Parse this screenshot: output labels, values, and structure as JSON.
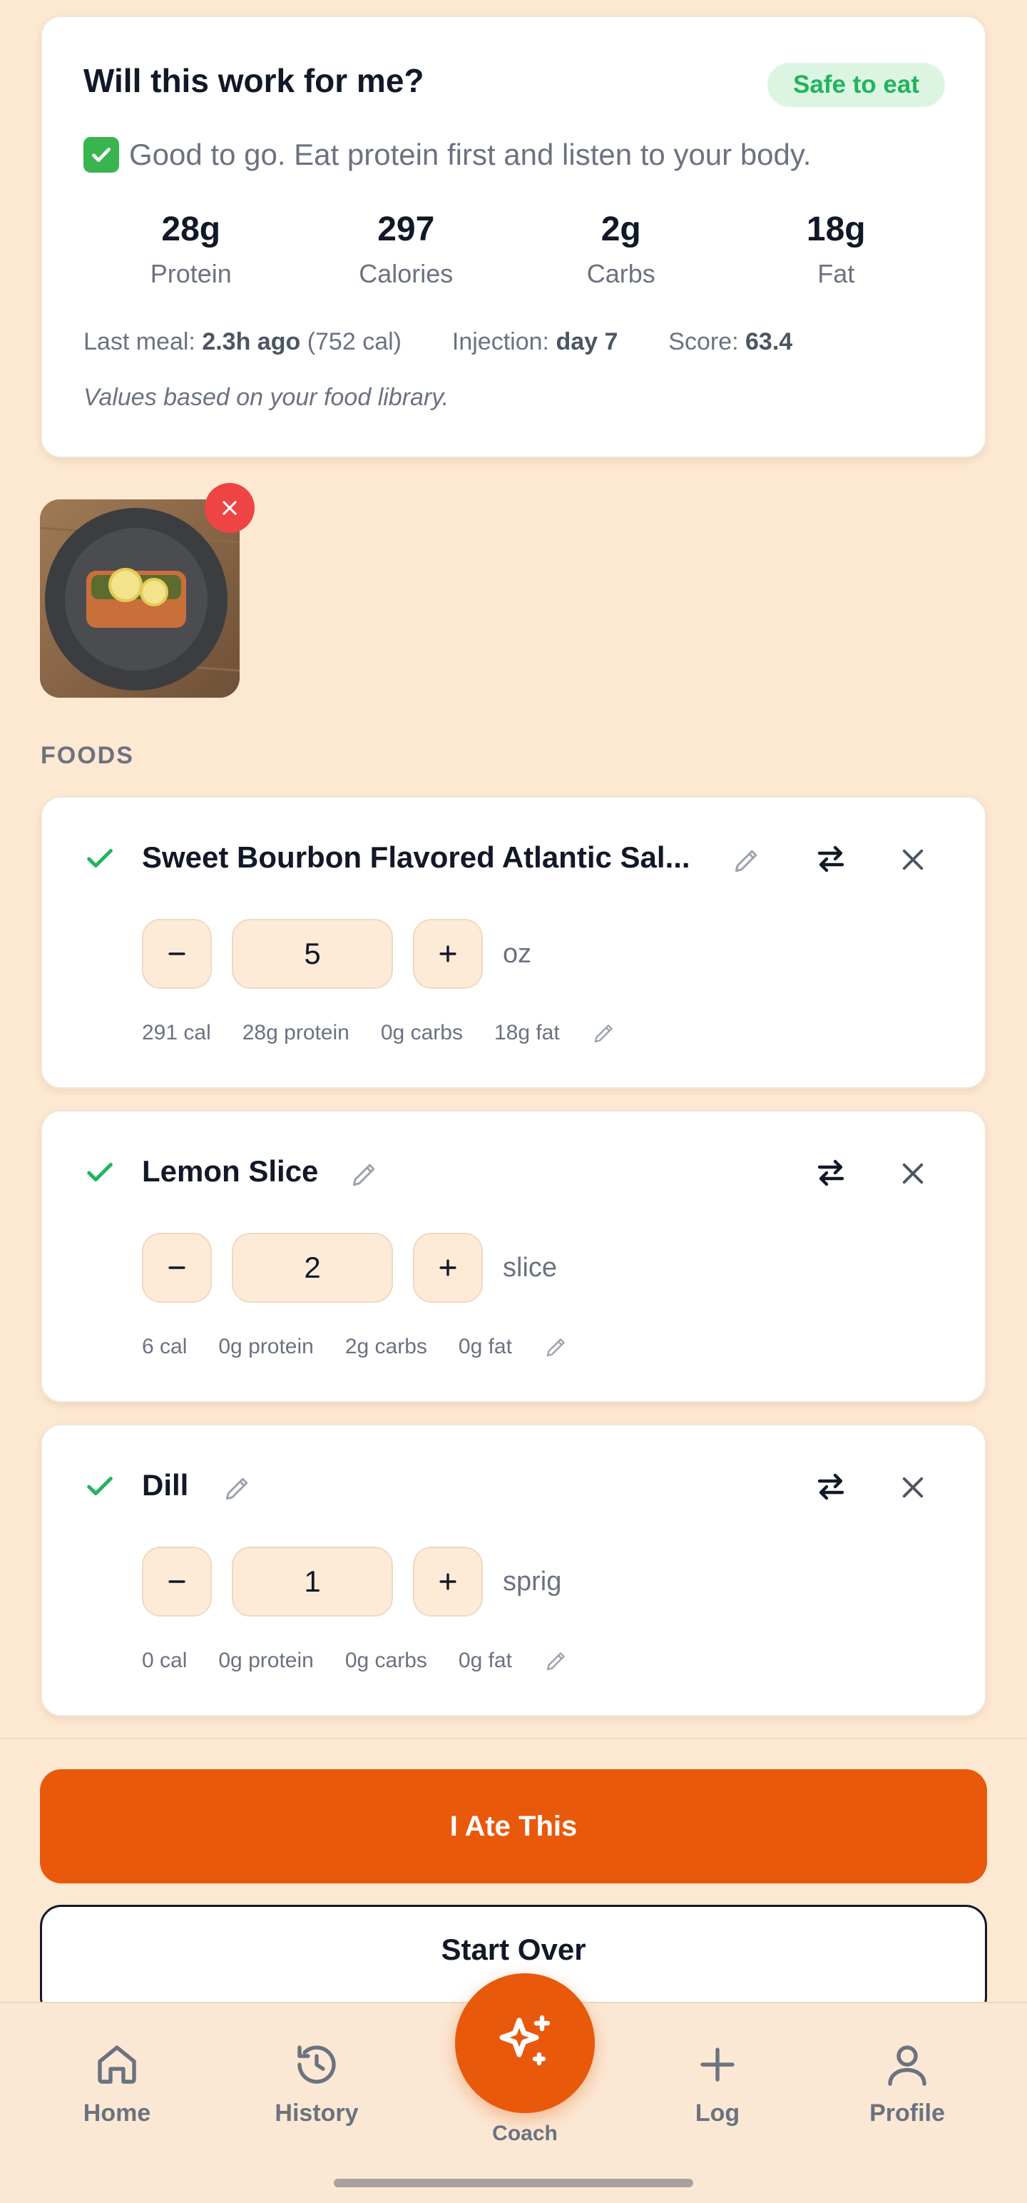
{
  "summary": {
    "title": "Will this work for me?",
    "badge": "Safe to eat",
    "verdict": "Good to go. Eat protein first and listen to your body.",
    "macros": [
      {
        "value": "28g",
        "label": "Protein"
      },
      {
        "value": "297",
        "label": "Calories"
      },
      {
        "value": "2g",
        "label": "Carbs"
      },
      {
        "value": "18g",
        "label": "Fat"
      }
    ],
    "last_meal_label": "Last meal:",
    "last_meal_value": "2.3h ago",
    "last_meal_cal": "(752 cal)",
    "injection_label": "Injection:",
    "injection_value": "day 7",
    "score_label": "Score:",
    "score_value": "63.4",
    "footnote": "Values based on your food library."
  },
  "section_label": "FOODS",
  "foods": [
    {
      "name": "Sweet Bourbon Flavored Atlantic Sal...",
      "quantity": "5",
      "unit": "oz",
      "cal": "291 cal",
      "protein": "28g protein",
      "carbs": "0g carbs",
      "fat": "18g fat"
    },
    {
      "name": "Lemon Slice",
      "quantity": "2",
      "unit": "slice",
      "cal": "6 cal",
      "protein": "0g protein",
      "carbs": "2g carbs",
      "fat": "0g fat"
    },
    {
      "name": "Dill",
      "quantity": "1",
      "unit": "sprig",
      "cal": "0 cal",
      "protein": "0g protein",
      "carbs": "0g carbs",
      "fat": "0g fat"
    }
  ],
  "actions": {
    "ate": "I Ate This",
    "start_over": "Start Over"
  },
  "nav": {
    "home": "Home",
    "history": "History",
    "coach": "Coach",
    "log": "Log",
    "profile": "Profile"
  },
  "colors": {
    "accent": "#e8590c",
    "safe": "#22b45c",
    "remove": "#ef4444"
  },
  "icons": [
    "check-icon",
    "pencil-icon",
    "swap-icon",
    "close-icon",
    "minus-icon",
    "plus-icon",
    "home-icon",
    "history-icon",
    "sparkle-icon",
    "user-icon"
  ]
}
